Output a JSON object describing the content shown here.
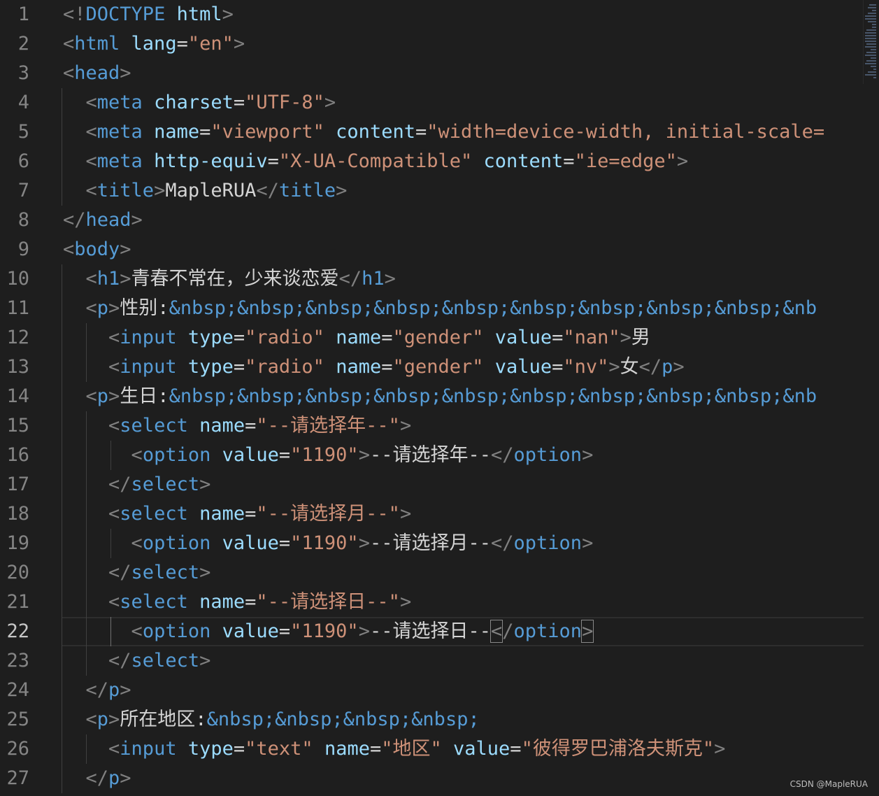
{
  "editor": {
    "active_line": 22,
    "lines": [
      {
        "n": "1",
        "t": [
          [
            "punc",
            "<"
          ],
          [
            "punc",
            "!"
          ],
          [
            "tag",
            "DOCTYPE "
          ],
          [
            "attr",
            "html"
          ],
          [
            "punc",
            ">"
          ]
        ]
      },
      {
        "n": "2",
        "t": [
          [
            "punc",
            "<"
          ],
          [
            "tag",
            "html "
          ],
          [
            "attr",
            "lang"
          ],
          [
            "txt",
            "="
          ],
          [
            "str",
            "\"en\""
          ],
          [
            "punc",
            ">"
          ]
        ]
      },
      {
        "n": "3",
        "t": [
          [
            "punc",
            "<"
          ],
          [
            "tag",
            "head"
          ],
          [
            "punc",
            ">"
          ]
        ]
      },
      {
        "n": "4",
        "t": [
          [
            "txt",
            "  "
          ],
          [
            "punc",
            "<"
          ],
          [
            "tag",
            "meta "
          ],
          [
            "attr",
            "charset"
          ],
          [
            "txt",
            "="
          ],
          [
            "str",
            "\"UTF-8\""
          ],
          [
            "punc",
            ">"
          ]
        ]
      },
      {
        "n": "5",
        "t": [
          [
            "txt",
            "  "
          ],
          [
            "punc",
            "<"
          ],
          [
            "tag",
            "meta "
          ],
          [
            "attr",
            "name"
          ],
          [
            "txt",
            "="
          ],
          [
            "str",
            "\"viewport\" "
          ],
          [
            "attr",
            "content"
          ],
          [
            "txt",
            "="
          ],
          [
            "str",
            "\"width=device-width, initial-scale="
          ]
        ]
      },
      {
        "n": "6",
        "t": [
          [
            "txt",
            "  "
          ],
          [
            "punc",
            "<"
          ],
          [
            "tag",
            "meta "
          ],
          [
            "attr",
            "http-equiv"
          ],
          [
            "txt",
            "="
          ],
          [
            "str",
            "\"X-UA-Compatible\" "
          ],
          [
            "attr",
            "content"
          ],
          [
            "txt",
            "="
          ],
          [
            "str",
            "\"ie=edge\""
          ],
          [
            "punc",
            ">"
          ]
        ]
      },
      {
        "n": "7",
        "t": [
          [
            "txt",
            "  "
          ],
          [
            "punc",
            "<"
          ],
          [
            "tag",
            "title"
          ],
          [
            "punc",
            ">"
          ],
          [
            "txt",
            "MapleRUA"
          ],
          [
            "punc",
            "</"
          ],
          [
            "tag",
            "title"
          ],
          [
            "punc",
            ">"
          ]
        ]
      },
      {
        "n": "8",
        "t": [
          [
            "punc",
            "</"
          ],
          [
            "tag",
            "head"
          ],
          [
            "punc",
            ">"
          ]
        ]
      },
      {
        "n": "9",
        "t": [
          [
            "punc",
            "<"
          ],
          [
            "tag",
            "body"
          ],
          [
            "punc",
            ">"
          ]
        ]
      },
      {
        "n": "10",
        "t": [
          [
            "txt",
            "  "
          ],
          [
            "punc",
            "<"
          ],
          [
            "tag",
            "h1"
          ],
          [
            "punc",
            ">"
          ],
          [
            "txt",
            "青春不常在，少来谈恋爱"
          ],
          [
            "punc",
            "</"
          ],
          [
            "tag",
            "h1"
          ],
          [
            "punc",
            ">"
          ]
        ]
      },
      {
        "n": "11",
        "t": [
          [
            "txt",
            "  "
          ],
          [
            "punc",
            "<"
          ],
          [
            "tag",
            "p"
          ],
          [
            "punc",
            ">"
          ],
          [
            "txt",
            "性别:"
          ],
          [
            "ent",
            "&nbsp;&nbsp;&nbsp;&nbsp;&nbsp;&nbsp;&nbsp;&nbsp;&nbsp;&nb"
          ]
        ]
      },
      {
        "n": "12",
        "t": [
          [
            "txt",
            "    "
          ],
          [
            "punc",
            "<"
          ],
          [
            "tag",
            "input "
          ],
          [
            "attr",
            "type"
          ],
          [
            "txt",
            "="
          ],
          [
            "str",
            "\"radio\" "
          ],
          [
            "attr",
            "name"
          ],
          [
            "txt",
            "="
          ],
          [
            "str",
            "\"gender\" "
          ],
          [
            "attr",
            "value"
          ],
          [
            "txt",
            "="
          ],
          [
            "str",
            "\"nan\""
          ],
          [
            "punc",
            ">"
          ],
          [
            "txt",
            "男"
          ]
        ]
      },
      {
        "n": "13",
        "t": [
          [
            "txt",
            "    "
          ],
          [
            "punc",
            "<"
          ],
          [
            "tag",
            "input "
          ],
          [
            "attr",
            "type"
          ],
          [
            "txt",
            "="
          ],
          [
            "str",
            "\"radio\" "
          ],
          [
            "attr",
            "name"
          ],
          [
            "txt",
            "="
          ],
          [
            "str",
            "\"gender\" "
          ],
          [
            "attr",
            "value"
          ],
          [
            "txt",
            "="
          ],
          [
            "str",
            "\"nv\""
          ],
          [
            "punc",
            ">"
          ],
          [
            "txt",
            "女"
          ],
          [
            "punc",
            "</"
          ],
          [
            "tag",
            "p"
          ],
          [
            "punc",
            ">"
          ]
        ]
      },
      {
        "n": "14",
        "t": [
          [
            "txt",
            "  "
          ],
          [
            "punc",
            "<"
          ],
          [
            "tag",
            "p"
          ],
          [
            "punc",
            ">"
          ],
          [
            "txt",
            "生日:"
          ],
          [
            "ent",
            "&nbsp;&nbsp;&nbsp;&nbsp;&nbsp;&nbsp;&nbsp;&nbsp;&nbsp;&nb"
          ]
        ]
      },
      {
        "n": "15",
        "t": [
          [
            "txt",
            "    "
          ],
          [
            "punc",
            "<"
          ],
          [
            "tag",
            "select "
          ],
          [
            "attr",
            "name"
          ],
          [
            "txt",
            "="
          ],
          [
            "str",
            "\"--请选择年--\""
          ],
          [
            "punc",
            ">"
          ]
        ]
      },
      {
        "n": "16",
        "t": [
          [
            "txt",
            "      "
          ],
          [
            "punc",
            "<"
          ],
          [
            "tag",
            "option "
          ],
          [
            "attr",
            "value"
          ],
          [
            "txt",
            "="
          ],
          [
            "str",
            "\"1190\""
          ],
          [
            "punc",
            ">"
          ],
          [
            "txt",
            "--请选择年--"
          ],
          [
            "punc",
            "</"
          ],
          [
            "tag",
            "option"
          ],
          [
            "punc",
            ">"
          ]
        ]
      },
      {
        "n": "17",
        "t": [
          [
            "txt",
            "    "
          ],
          [
            "punc",
            "</"
          ],
          [
            "tag",
            "select"
          ],
          [
            "punc",
            ">"
          ]
        ]
      },
      {
        "n": "18",
        "t": [
          [
            "txt",
            "    "
          ],
          [
            "punc",
            "<"
          ],
          [
            "tag",
            "select "
          ],
          [
            "attr",
            "name"
          ],
          [
            "txt",
            "="
          ],
          [
            "str",
            "\"--请选择月--\""
          ],
          [
            "punc",
            ">"
          ]
        ]
      },
      {
        "n": "19",
        "t": [
          [
            "txt",
            "      "
          ],
          [
            "punc",
            "<"
          ],
          [
            "tag",
            "option "
          ],
          [
            "attr",
            "value"
          ],
          [
            "txt",
            "="
          ],
          [
            "str",
            "\"1190\""
          ],
          [
            "punc",
            ">"
          ],
          [
            "txt",
            "--请选择月--"
          ],
          [
            "punc",
            "</"
          ],
          [
            "tag",
            "option"
          ],
          [
            "punc",
            ">"
          ]
        ]
      },
      {
        "n": "20",
        "t": [
          [
            "txt",
            "    "
          ],
          [
            "punc",
            "</"
          ],
          [
            "tag",
            "select"
          ],
          [
            "punc",
            ">"
          ]
        ]
      },
      {
        "n": "21",
        "t": [
          [
            "txt",
            "    "
          ],
          [
            "punc",
            "<"
          ],
          [
            "tag",
            "select "
          ],
          [
            "attr",
            "name"
          ],
          [
            "txt",
            "="
          ],
          [
            "str",
            "\"--请选择日--\""
          ],
          [
            "punc",
            ">"
          ]
        ]
      },
      {
        "n": "22",
        "t": [
          [
            "txt",
            "      "
          ],
          [
            "punc",
            "<"
          ],
          [
            "tag",
            "option "
          ],
          [
            "attr",
            "value"
          ],
          [
            "txt",
            "="
          ],
          [
            "str",
            "\"1190\""
          ],
          [
            "punc",
            ">"
          ],
          [
            "txt",
            "--请选择日--"
          ],
          [
            "hl",
            "<"
          ],
          [
            "punc",
            "/"
          ],
          [
            "tag",
            "option"
          ],
          [
            "hl",
            ">"
          ]
        ]
      },
      {
        "n": "23",
        "t": [
          [
            "txt",
            "    "
          ],
          [
            "punc",
            "</"
          ],
          [
            "tag",
            "select"
          ],
          [
            "punc",
            ">"
          ]
        ]
      },
      {
        "n": "24",
        "t": [
          [
            "txt",
            "  "
          ],
          [
            "punc",
            "</"
          ],
          [
            "tag",
            "p"
          ],
          [
            "punc",
            ">"
          ]
        ]
      },
      {
        "n": "25",
        "t": [
          [
            "txt",
            "  "
          ],
          [
            "punc",
            "<"
          ],
          [
            "tag",
            "p"
          ],
          [
            "punc",
            ">"
          ],
          [
            "txt",
            "所在地区:"
          ],
          [
            "ent",
            "&nbsp;&nbsp;&nbsp;&nbsp;"
          ]
        ]
      },
      {
        "n": "26",
        "t": [
          [
            "txt",
            "    "
          ],
          [
            "punc",
            "<"
          ],
          [
            "tag",
            "input "
          ],
          [
            "attr",
            "type"
          ],
          [
            "txt",
            "="
          ],
          [
            "str",
            "\"text\" "
          ],
          [
            "attr",
            "name"
          ],
          [
            "txt",
            "="
          ],
          [
            "str",
            "\"地区\" "
          ],
          [
            "attr",
            "value"
          ],
          [
            "txt",
            "="
          ],
          [
            "str",
            "\"彼得罗巴浦洛夫斯克\""
          ],
          [
            "punc",
            ">"
          ]
        ]
      },
      {
        "n": "27",
        "t": [
          [
            "txt",
            "  "
          ],
          [
            "punc",
            "</"
          ],
          [
            "tag",
            "p"
          ],
          [
            "punc",
            ">"
          ]
        ]
      }
    ]
  },
  "watermark": "CSDN @MapleRUA"
}
